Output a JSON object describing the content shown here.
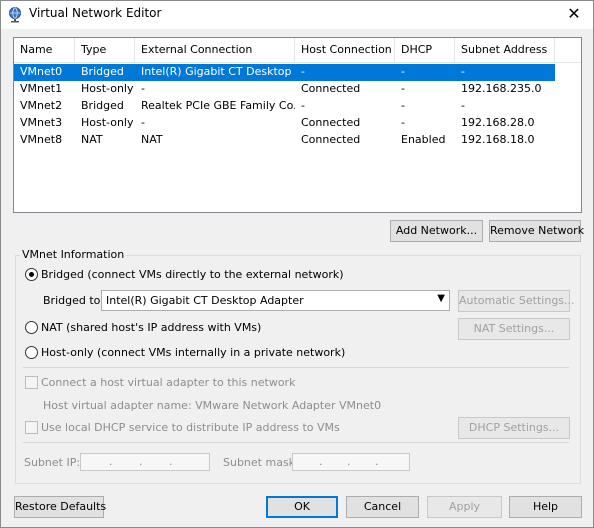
{
  "window": {
    "title": "Virtual Network Editor"
  },
  "table": {
    "columns": [
      "Name",
      "Type",
      "External Connection",
      "Host Connection",
      "DHCP",
      "Subnet Address"
    ],
    "rows": [
      [
        "VMnet0",
        "Bridged",
        "Intel(R) Gigabit CT Desktop ...",
        "-",
        "-",
        "-"
      ],
      [
        "VMnet1",
        "Host-only",
        "-",
        "Connected",
        "-",
        "192.168.235.0"
      ],
      [
        "VMnet2",
        "Bridged",
        "Realtek PCIe GBE Family Co...",
        "-",
        "-",
        "-"
      ],
      [
        "VMnet3",
        "Host-only",
        "-",
        "Connected",
        "-",
        "192.168.28.0"
      ],
      [
        "VMnet8",
        "NAT",
        "NAT",
        "Connected",
        "Enabled",
        "192.168.18.0"
      ]
    ]
  },
  "buttons": {
    "add_network": "Add Network...",
    "remove_network": "Remove Network",
    "automatic_settings": "Automatic Settings...",
    "nat_settings": "NAT Settings...",
    "dhcp_settings": "DHCP Settings...",
    "restore_defaults": "Restore Defaults",
    "ok": "OK",
    "cancel": "Cancel",
    "apply": "Apply",
    "help": "Help"
  },
  "vmnet_info": {
    "group_label": "VMnet Information",
    "bridged_label": "Bridged (connect VMs directly to the external network)",
    "bridged_to_label": "Bridged to:",
    "bridged_to_value": "Intel(R) Gigabit CT Desktop Adapter",
    "nat_label": "NAT (shared host's IP address with VMs)",
    "host_only_label": "Host-only (connect VMs internally in a private network)",
    "connect_adapter_label": "Connect a host virtual adapter to this network",
    "adapter_name_text": "Host virtual adapter name: VMware Network Adapter VMnet0",
    "dhcp_label": "Use local DHCP service to distribute IP address to VMs",
    "subnet_ip_label": "Subnet IP:",
    "subnet_mask_label": "Subnet mask:",
    "ip_dots": ".",
    "selected_mode": "Bridged"
  },
  "icons": {
    "title": "network-globe-icon",
    "close": "close-icon",
    "dropdown": "chevron-down-icon"
  },
  "colors": {
    "selection": "#0078d7",
    "default_button_border": "#0078d7"
  }
}
